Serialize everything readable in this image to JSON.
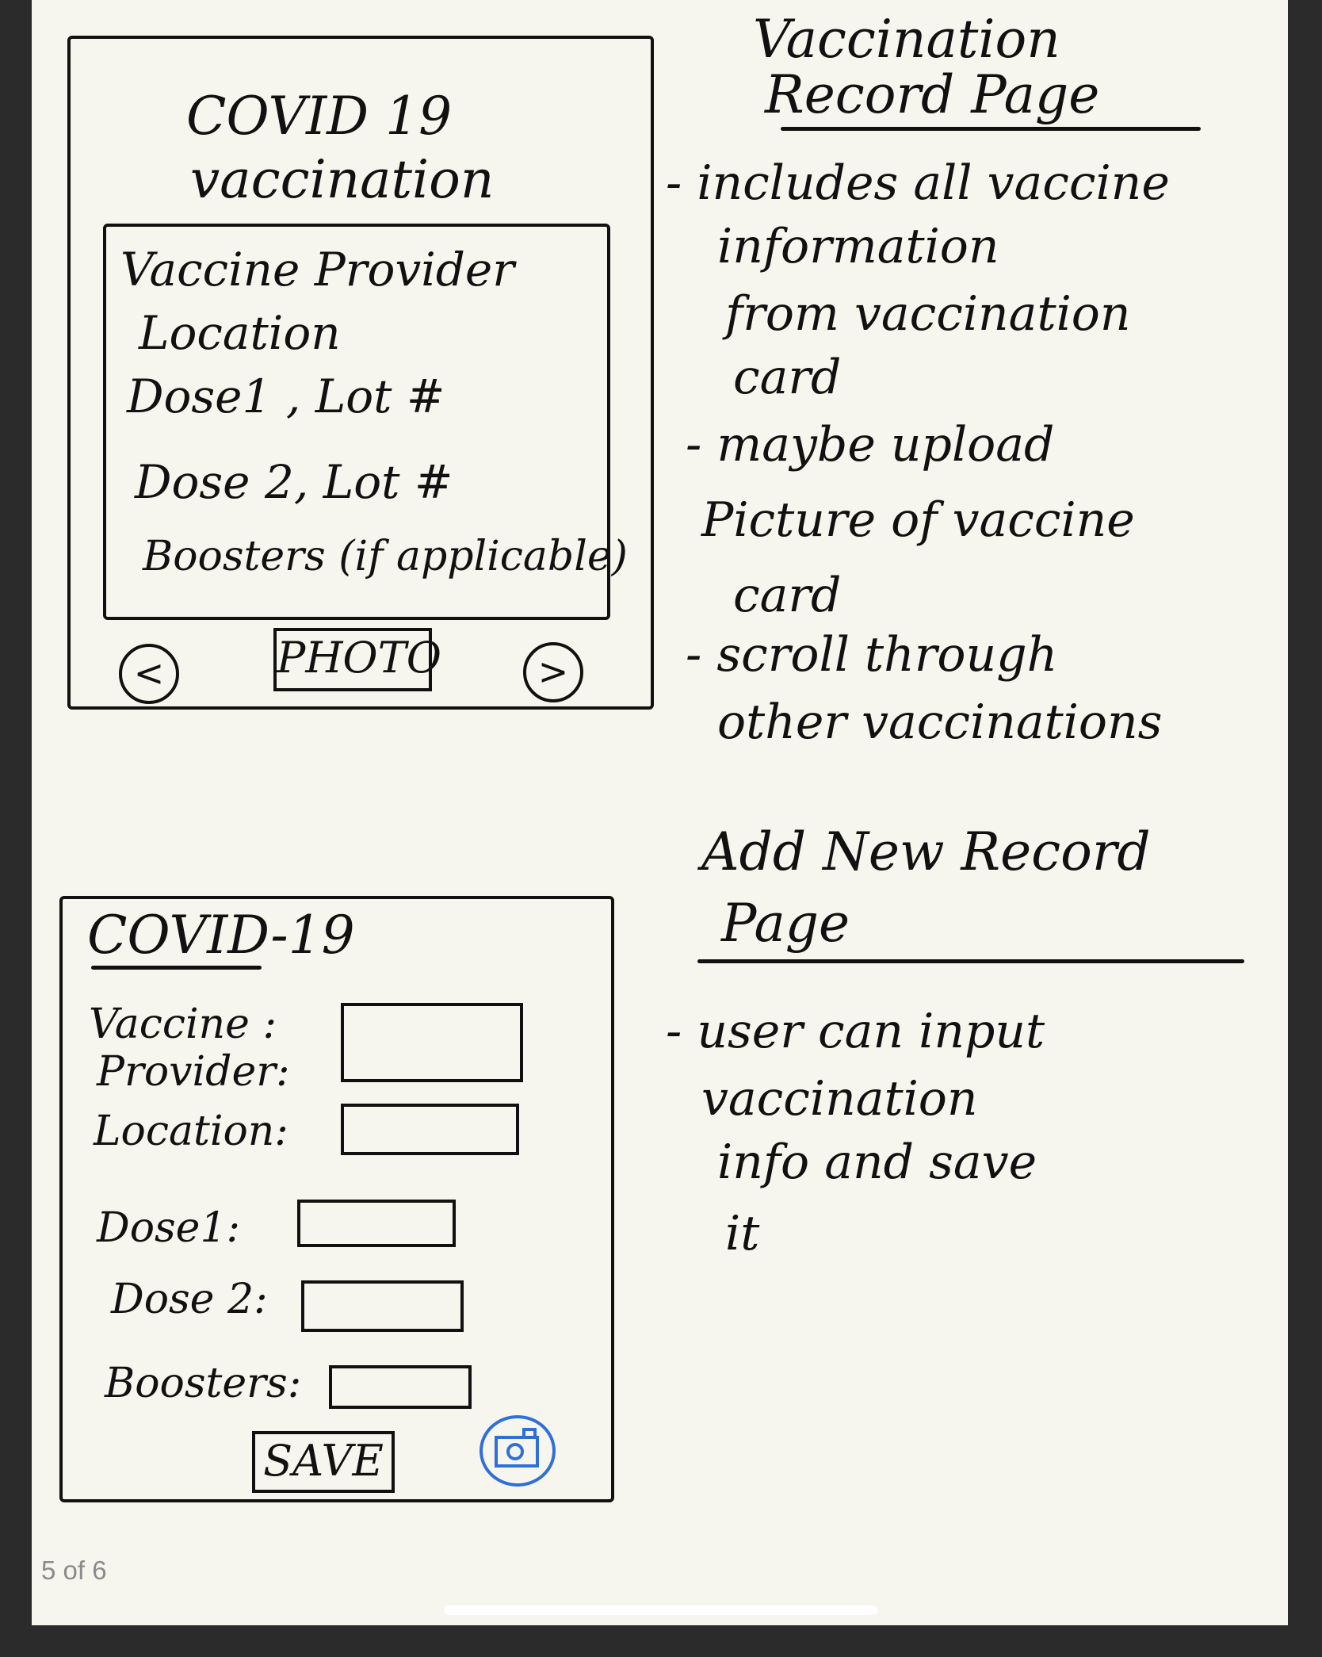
{
  "page_indicator": "5 of 6",
  "record_mockup": {
    "title_line1": "COVID 19",
    "title_line2": "vaccination",
    "details": [
      "Vaccine Provider",
      "Location",
      "Dose1 , Lot #",
      "Dose 2, Lot #",
      "Boosters (if applicable)"
    ],
    "photo_label": "PHOTO",
    "prev_symbol": "<",
    "next_symbol": ">"
  },
  "record_notes": {
    "heading_line1": "Vaccination",
    "heading_line2": "Record Page",
    "lines": [
      "- includes all vaccine",
      "information",
      "from vaccination",
      "card",
      "- maybe upload",
      "Picture of vaccine",
      "card",
      "- scroll through",
      "other vaccinations"
    ]
  },
  "add_mockup": {
    "title": "COVID-19",
    "vaccine_label_line1": "Vaccine :",
    "vaccine_label_line2": "Provider:",
    "location_label": "Location:",
    "dose1_label": "Dose1:",
    "dose2_label": "Dose 2:",
    "boosters_label": "Boosters:",
    "save_label": "SAVE",
    "camera_icon": "camera-icon"
  },
  "add_notes": {
    "heading_line1": "Add New Record",
    "heading_line2": "Page",
    "lines": [
      "- user can input",
      "vaccination",
      "info and save",
      "it"
    ]
  },
  "colors": {
    "paper": "#f6f6ee",
    "ink": "#111111",
    "camera_accent": "#2f6fd8"
  }
}
